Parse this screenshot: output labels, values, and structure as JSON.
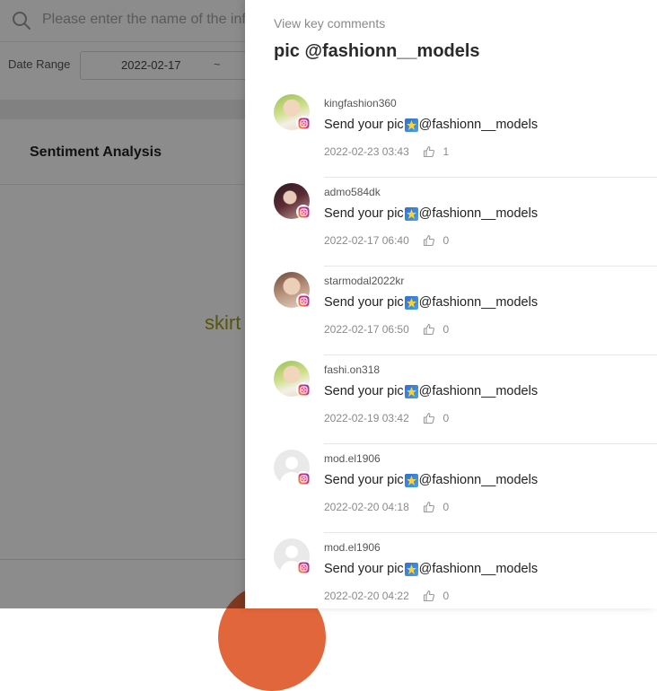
{
  "background": {
    "search_placeholder": "Please enter the name of the inf",
    "date_range_label": "Date Range",
    "date_start": "2022-02-17",
    "date_separator": "~",
    "section_title": "Sentiment Analysis",
    "partial_word": "skirt"
  },
  "drawer": {
    "kicker": "View key comments",
    "title": "pic @fashionn__models",
    "comments": [
      {
        "username": "kingfashion360",
        "text_pre": "Send your pic",
        "text_post": "@fashionn__models",
        "date": "2022-02-23 03:43",
        "likes": "1",
        "avatar": "photo1"
      },
      {
        "username": "admo584dk",
        "text_pre": "Send your pic",
        "text_post": "@fashionn__models",
        "date": "2022-02-17 06:40",
        "likes": "0",
        "avatar": "photo2"
      },
      {
        "username": "starmodal2022kr",
        "text_pre": "Send your pic",
        "text_post": "@fashionn__models",
        "date": "2022-02-17 06:50",
        "likes": "0",
        "avatar": "photo3"
      },
      {
        "username": "fashi.on318",
        "text_pre": "Send your pic",
        "text_post": "@fashionn__models",
        "date": "2022-02-19 03:42",
        "likes": "0",
        "avatar": "photo1"
      },
      {
        "username": "mod.el1906",
        "text_pre": "Send your pic",
        "text_post": "@fashionn__models",
        "date": "2022-02-20 04:18",
        "likes": "0",
        "avatar": "default"
      },
      {
        "username": "mod.el1906",
        "text_pre": "Send your pic",
        "text_post": "@fashionn__models",
        "date": "2022-02-20 04:22",
        "likes": "0",
        "avatar": "default"
      }
    ]
  },
  "colors": {
    "overlay": "#000000",
    "keyword": "#9f9a16",
    "chart_slice": "#e2663b",
    "star_badge": "#2f6fd6"
  },
  "icons": {
    "search": "search-icon",
    "platform": "instagram-icon",
    "emoji": "star-emoji-icon",
    "like": "thumbs-up-icon"
  }
}
